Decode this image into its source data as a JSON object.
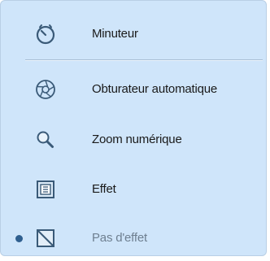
{
  "menu": {
    "items": [
      {
        "label": "Minuteur",
        "icon": "timer-icon",
        "selected": false,
        "disabled": false
      },
      {
        "label": "Obturateur automatique",
        "icon": "aperture-icon",
        "selected": false,
        "disabled": false
      },
      {
        "label": "Zoom numérique",
        "icon": "magnifier-icon",
        "selected": false,
        "disabled": false
      },
      {
        "label": "Effet",
        "icon": "effect-icon",
        "selected": false,
        "disabled": false
      },
      {
        "label": "Pas d'effet",
        "icon": "no-effect-icon",
        "selected": true,
        "disabled": true
      }
    ]
  },
  "colors": {
    "menu_background": "#cfe5fa",
    "icon_stroke": "#3a5a78",
    "bullet": "#2f5f8f",
    "disabled_text": "#6e7f90"
  }
}
